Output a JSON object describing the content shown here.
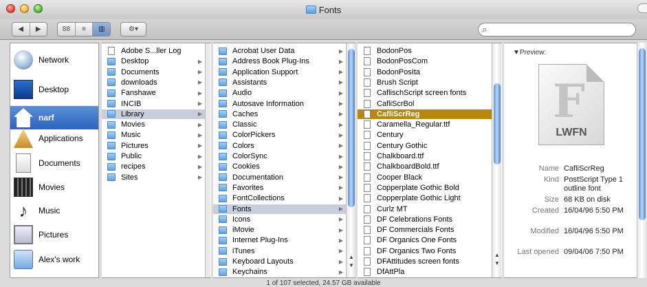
{
  "window": {
    "title": "Fonts"
  },
  "toolbar": {
    "back": "◀",
    "forward": "▶",
    "view_icon": "88",
    "view_list": "≡",
    "view_column": "▥",
    "action": "⚙▾",
    "search_placeholder": ""
  },
  "sidebar": {
    "items": [
      {
        "label": "Network",
        "icon": "network-icon"
      },
      {
        "label": "Desktop",
        "icon": "desktop-icon"
      },
      {
        "label": "narf",
        "icon": "home-icon",
        "selected": true
      },
      {
        "label": "Applications",
        "icon": "applications-icon"
      },
      {
        "label": "Documents",
        "icon": "documents-icon"
      },
      {
        "label": "Movies",
        "icon": "movies-icon"
      },
      {
        "label": "Music",
        "icon": "music-icon"
      },
      {
        "label": "Pictures",
        "icon": "pictures-icon"
      },
      {
        "label": "Alex's work",
        "icon": "folder-icon"
      }
    ]
  },
  "columns": [
    {
      "items": [
        {
          "name": "Adobe S...ller Log",
          "kind": "doc",
          "arrow": false
        },
        {
          "name": "Desktop",
          "kind": "folder",
          "arrow": true
        },
        {
          "name": "Documents",
          "kind": "folder",
          "arrow": true
        },
        {
          "name": "downloads",
          "kind": "folder",
          "arrow": true
        },
        {
          "name": "Fanshawe",
          "kind": "folder",
          "arrow": true
        },
        {
          "name": "INCIB",
          "kind": "folder",
          "arrow": true
        },
        {
          "name": "Library",
          "kind": "folder",
          "arrow": true,
          "selected": true
        },
        {
          "name": "Movies",
          "kind": "folder",
          "arrow": true
        },
        {
          "name": "Music",
          "kind": "folder",
          "arrow": true
        },
        {
          "name": "Pictures",
          "kind": "folder",
          "arrow": true
        },
        {
          "name": "Public",
          "kind": "folder",
          "arrow": true
        },
        {
          "name": "recipes",
          "kind": "folder",
          "arrow": true
        },
        {
          "name": "Sites",
          "kind": "folder",
          "arrow": true
        }
      ]
    },
    {
      "items": [
        {
          "name": "Acrobat User Data",
          "kind": "folder",
          "arrow": true
        },
        {
          "name": "Address Book Plug-Ins",
          "kind": "folder",
          "arrow": true
        },
        {
          "name": "Application Support",
          "kind": "folder",
          "arrow": true
        },
        {
          "name": "Assistants",
          "kind": "folder",
          "arrow": true
        },
        {
          "name": "Audio",
          "kind": "folder",
          "arrow": true
        },
        {
          "name": "Autosave Information",
          "kind": "folder",
          "arrow": true
        },
        {
          "name": "Caches",
          "kind": "folder",
          "arrow": true
        },
        {
          "name": "Classic",
          "kind": "folder",
          "arrow": true
        },
        {
          "name": "ColorPickers",
          "kind": "folder",
          "arrow": true
        },
        {
          "name": "Colors",
          "kind": "folder",
          "arrow": true
        },
        {
          "name": "ColorSync",
          "kind": "folder",
          "arrow": true
        },
        {
          "name": "Cookies",
          "kind": "folder",
          "arrow": true
        },
        {
          "name": "Documentation",
          "kind": "folder",
          "arrow": true
        },
        {
          "name": "Favorites",
          "kind": "folder",
          "arrow": true
        },
        {
          "name": "FontCollections",
          "kind": "folder",
          "arrow": true
        },
        {
          "name": "Fonts",
          "kind": "folder",
          "arrow": true,
          "selected": true
        },
        {
          "name": "Icons",
          "kind": "folder",
          "arrow": true
        },
        {
          "name": "iMovie",
          "kind": "folder",
          "arrow": true
        },
        {
          "name": "Internet Plug-Ins",
          "kind": "folder",
          "arrow": true
        },
        {
          "name": "iTunes",
          "kind": "folder",
          "arrow": true
        },
        {
          "name": "Keyboard Layouts",
          "kind": "folder",
          "arrow": true
        },
        {
          "name": "Keychains",
          "kind": "folder",
          "arrow": true
        }
      ]
    },
    {
      "items": [
        {
          "name": "BodonPos",
          "kind": "doc"
        },
        {
          "name": "BodonPosCom",
          "kind": "doc"
        },
        {
          "name": "BodonPosIta",
          "kind": "doc"
        },
        {
          "name": "Brush Script",
          "kind": "doc"
        },
        {
          "name": "CaflischScript screen fonts",
          "kind": "doc"
        },
        {
          "name": "CafliScrBol",
          "kind": "doc"
        },
        {
          "name": "CafliScrReg",
          "kind": "doc",
          "highlighted": true
        },
        {
          "name": "Caramella_Regular.ttf",
          "kind": "doc"
        },
        {
          "name": "Century",
          "kind": "doc"
        },
        {
          "name": "Century Gothic",
          "kind": "doc"
        },
        {
          "name": "Chalkboard.ttf",
          "kind": "doc"
        },
        {
          "name": "ChalkboardBold.ttf",
          "kind": "doc"
        },
        {
          "name": "Cooper Black",
          "kind": "doc"
        },
        {
          "name": "Copperplate Gothic Bold",
          "kind": "doc"
        },
        {
          "name": "Copperplate Gothic Light",
          "kind": "doc"
        },
        {
          "name": "Curlz MT",
          "kind": "doc"
        },
        {
          "name": "DF Celebrations Fonts",
          "kind": "doc"
        },
        {
          "name": "DF Commercials Fonts",
          "kind": "doc"
        },
        {
          "name": "DF Organics One Fonts",
          "kind": "doc"
        },
        {
          "name": "DF Organics Two Fonts",
          "kind": "doc"
        },
        {
          "name": "DFAttitudes screen fonts",
          "kind": "doc"
        },
        {
          "name": "DfAttPla",
          "kind": "doc"
        }
      ]
    }
  ],
  "preview": {
    "label": "▼Preview:",
    "icon_letter": "F",
    "icon_badge": "LWFN",
    "fields": [
      {
        "key": "Name",
        "value": "CafliScrReg"
      },
      {
        "key": "Kind",
        "value": "PostScript Type 1 outline font"
      },
      {
        "key": "Size",
        "value": "68 KB on disk"
      },
      {
        "key": "Created",
        "value": "16/04/96 5:50 PM"
      },
      {
        "key": "Modified",
        "value": "16/04/96 5:50 PM"
      },
      {
        "key": "Last opened",
        "value": "09/04/06 7:50 PM"
      }
    ]
  },
  "status": "1 of 107 selected, 24.57 GB available"
}
